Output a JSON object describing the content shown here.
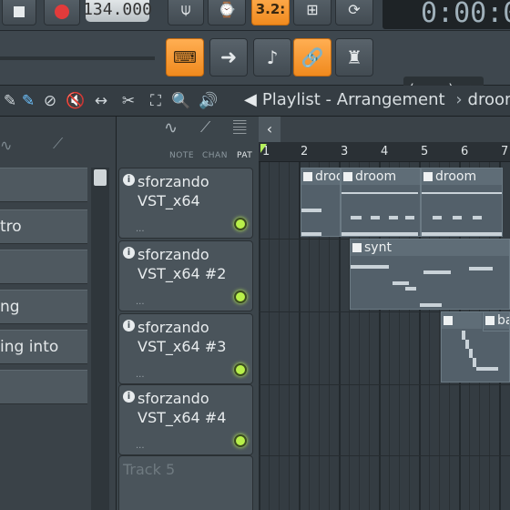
{
  "toolbar": {
    "tempo": "134.000",
    "pattern_number": "3.2:",
    "time": "0:00:0",
    "output_select": "(none)"
  },
  "playlist": {
    "title": "Playlist - Arrangement",
    "breadcrumb_next": "droom",
    "tabs": [
      "NOTE",
      "CHAN",
      "PAT"
    ],
    "ruler": [
      "1",
      "2",
      "3",
      "4",
      "5",
      "6",
      "7"
    ],
    "clips": [
      {
        "label": "droo"
      },
      {
        "label": "droom"
      },
      {
        "label": "droom"
      },
      {
        "label": "synt"
      },
      {
        "label": "ba"
      }
    ]
  },
  "browser": {
    "items": [
      "",
      "tro",
      "",
      "ng",
      "ing into",
      ""
    ]
  },
  "tracks": [
    {
      "name_line1": "sforzando",
      "name_line2": "VST_x64",
      "dots": "..."
    },
    {
      "name_line1": "sforzando",
      "name_line2": "VST_x64 #2",
      "dots": "..."
    },
    {
      "name_line1": "sforzando",
      "name_line2": "VST_x64 #3",
      "dots": "..."
    },
    {
      "name_line1": "sforzando",
      "name_line2": "VST_x64 #4",
      "dots": "..."
    },
    {
      "name_line1": "Track 5",
      "name_line2": "",
      "dots": ""
    }
  ],
  "colors": {
    "accent_orange": "#f7a23a",
    "led_green": "#b8f04a",
    "panel": "#3c454b"
  }
}
